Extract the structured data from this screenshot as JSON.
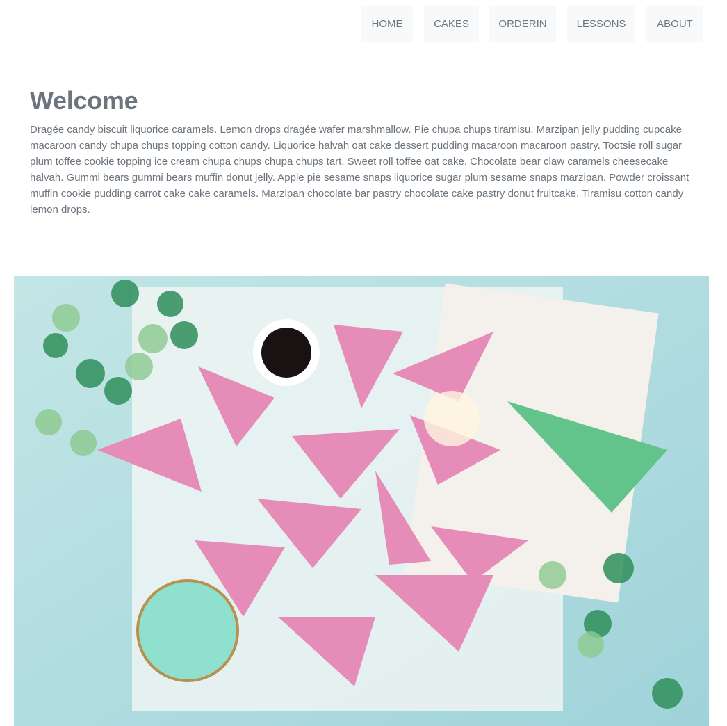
{
  "nav": {
    "items": [
      {
        "label": "HOME"
      },
      {
        "label": "CAKES"
      },
      {
        "label": "ORDERIN"
      },
      {
        "label": "LESSONS"
      },
      {
        "label": "ABOUT"
      }
    ]
  },
  "main": {
    "title": "Welcome",
    "intro": "Dragée candy biscuit liquorice caramels. Lemon drops dragée wafer marshmallow. Pie chupa chups tiramisu. Marzipan jelly pudding cupcake macaroon candy chupa chups topping cotton candy. Liquorice halvah oat cake dessert pudding macaroon macaroon pastry. Tootsie roll sugar plum toffee cookie topping ice cream chupa chups chupa chups tart. Sweet roll toffee oat cake. Chocolate bear claw caramels cheesecake halvah. Gummi bears gummi bears muffin donut jelly. Apple pie sesame snaps liquorice sugar plum sesame snaps marzipan. Powder croissant muffin cookie pudding carrot cake cake caramels. Marzipan chocolate bar pastry chocolate cake pastry donut fruitcake. Tiramisu cotton candy lemon drops."
  },
  "hero": {
    "icon": "party-cakes-photo"
  }
}
